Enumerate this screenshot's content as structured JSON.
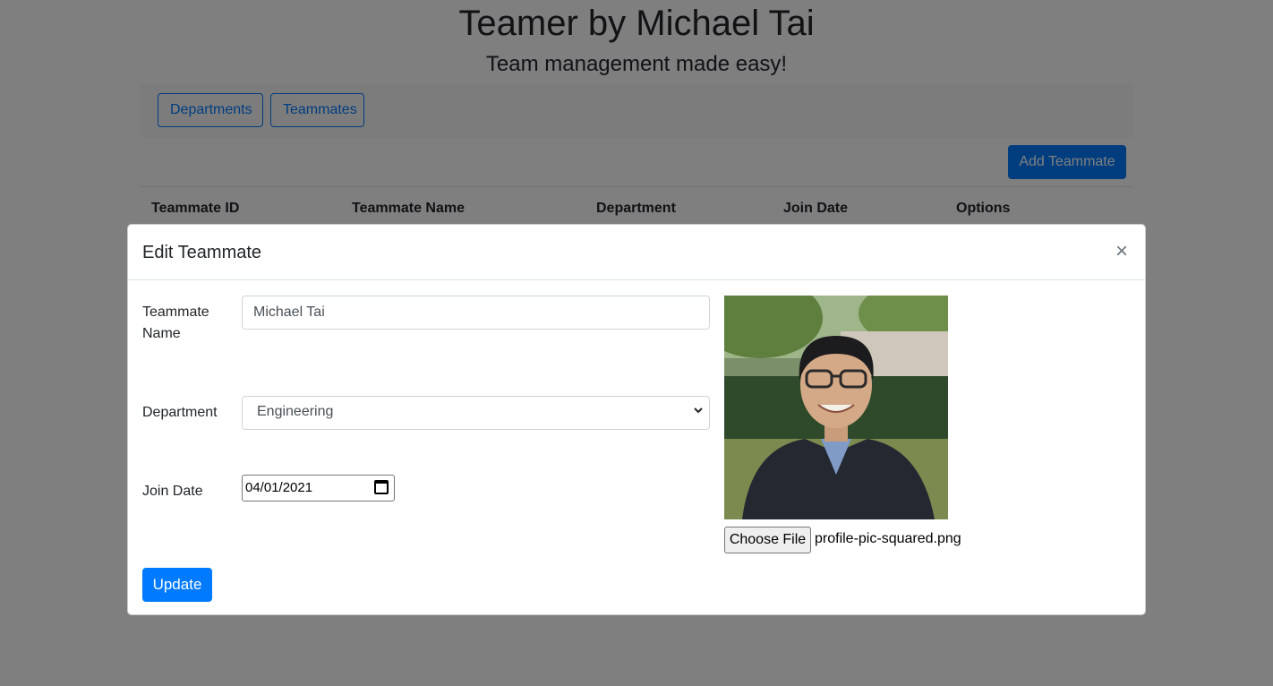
{
  "header": {
    "title": "Teamer by Michael Tai",
    "subtitle": "Team management made easy!"
  },
  "nav": {
    "departments_label": "Departments",
    "teammates_label": "Teammates"
  },
  "toolbar": {
    "add_label": "Add Teammate"
  },
  "table": {
    "columns": [
      "Teammate ID",
      "Teammate Name",
      "Department",
      "Join Date",
      "Options"
    ]
  },
  "modal": {
    "title": "Edit Teammate",
    "close_symbol": "×",
    "name_label": "Teammate Name",
    "name_value": "Michael Tai",
    "department_label": "Department",
    "department_value": "Engineering",
    "join_label": "Join Date",
    "join_value": "04/01/2021",
    "choose_file_label": "Choose File",
    "file_name": "profile-pic-squared.png",
    "update_label": "Update"
  },
  "colors": {
    "primary": "#007bff",
    "backdrop": "rgba(0,0,0,0.5)"
  },
  "icons": {
    "close": "close-icon",
    "select_caret": "chevron-down-icon",
    "calendar": "calendar-icon"
  }
}
